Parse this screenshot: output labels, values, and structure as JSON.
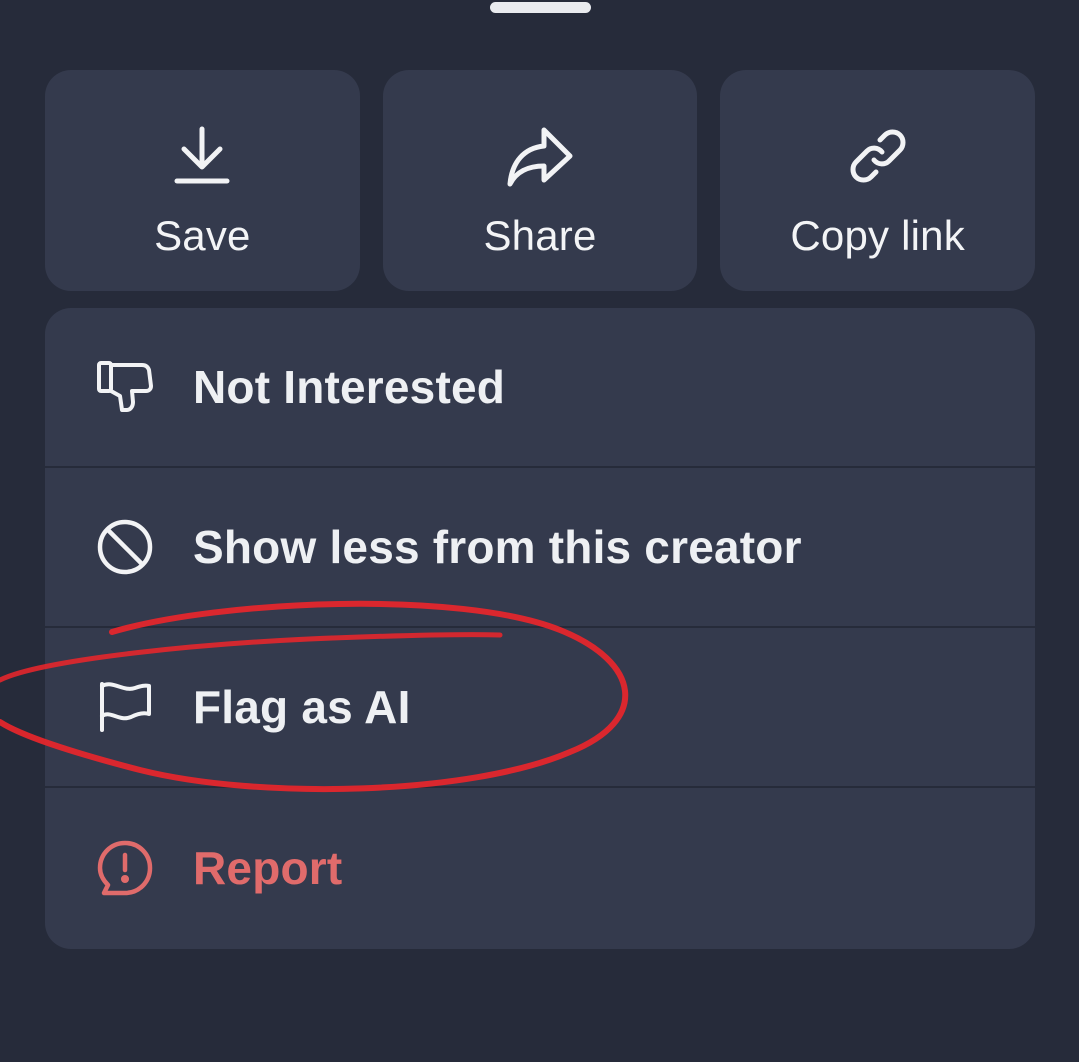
{
  "colors": {
    "background": "#262b3a",
    "card": "#343a4d",
    "text": "#f2f3f5",
    "danger": "#e06b6b",
    "annotation": "#e8262b"
  },
  "actions": [
    {
      "label": "Save",
      "icon": "download-icon"
    },
    {
      "label": "Share",
      "icon": "share-icon"
    },
    {
      "label": "Copy link",
      "icon": "link-icon"
    }
  ],
  "menu": [
    {
      "label": "Not Interested",
      "icon": "thumbs-down-icon"
    },
    {
      "label": "Show less from this creator",
      "icon": "block-icon"
    },
    {
      "label": "Flag as AI",
      "icon": "flag-icon"
    },
    {
      "label": "Report",
      "icon": "report-icon"
    }
  ]
}
